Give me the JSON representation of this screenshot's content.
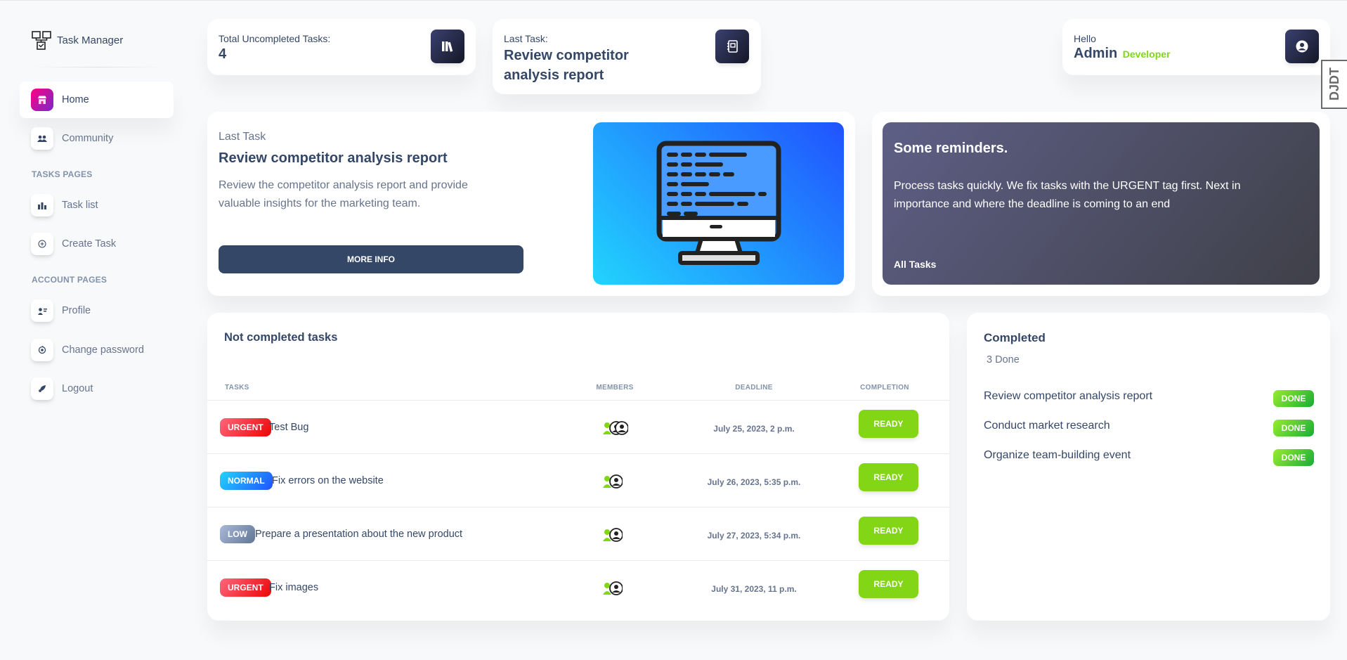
{
  "brand": {
    "name": "Task Manager",
    "icon": "sitemap-icon"
  },
  "sidebar": {
    "items": [
      {
        "label": "Home",
        "icon": "shop-icon"
      },
      {
        "label": "Community",
        "icon": "people-icon"
      },
      {
        "label": "Task list",
        "icon": "chart-bar-icon"
      },
      {
        "label": "Create Task",
        "icon": "plus-circle-icon"
      },
      {
        "label": "Profile",
        "icon": "user-card-icon"
      },
      {
        "label": "Change password",
        "icon": "key-icon"
      },
      {
        "label": "Logout",
        "icon": "rocket-icon"
      }
    ],
    "sections": {
      "tasks": "TASKS PAGES",
      "account": "ACCOUNT PAGES"
    }
  },
  "stats": {
    "uncompleted": {
      "label": "Total Uncompleted Tasks:",
      "value": "4",
      "icon": "books-icon"
    },
    "last_task": {
      "label": "Last Task:",
      "value_line1": "Review competitor",
      "value_line2": "analysis report",
      "icon": "notebook-icon"
    },
    "user": {
      "greeting": "Hello",
      "name": "Admin",
      "role": "Developer",
      "icon": "user-circle-icon"
    }
  },
  "hero": {
    "eyebrow": "Last Task",
    "title": "Review competitor analysis report",
    "description_line1": "Review the competitor analysis report and provide",
    "description_line2": "valuable insights for the marketing team.",
    "button": "MORE INFO",
    "image_icon": "monitor-code-icon"
  },
  "reminders": {
    "title": "Some reminders.",
    "text_line1": "Process tasks quickly. We fix tasks with the URGENT tag first. Next in",
    "text_line2": "importance and where the deadline is coming to an end",
    "link": "All Tasks"
  },
  "tasks_table": {
    "title": "Not completed tasks",
    "headers": [
      "TASKS",
      "MEMBERS",
      "DEADLINE",
      "COMPLETION"
    ],
    "rows": [
      {
        "priority": "URGENT",
        "priority_color": "#ea0606",
        "name": "Test Bug",
        "deadline": "July 25, 2023, 2 p.m.",
        "action": "READY",
        "members": 3
      },
      {
        "priority": "NORMAL",
        "priority_color": "#21d4fd",
        "name": "Fix errors on the website",
        "deadline": "July 26, 2023, 5:35 p.m.",
        "action": "READY",
        "members": 2
      },
      {
        "priority": "LOW",
        "priority_color": "#8392ab",
        "name": "Prepare a presentation about the new product",
        "deadline": "July 27, 2023, 5:34 p.m.",
        "action": "READY",
        "members": 2
      },
      {
        "priority": "URGENT",
        "priority_color": "#ea0606",
        "name": "Fix images",
        "deadline": "July 31, 2023, 11 p.m.",
        "action": "READY",
        "members": 2
      }
    ]
  },
  "completed": {
    "title": "Completed",
    "count": "3 Done",
    "items": [
      {
        "name": "Review competitor analysis report",
        "badge": "DONE"
      },
      {
        "name": "Conduct market research",
        "badge": "DONE"
      },
      {
        "name": "Organize team-building event",
        "badge": "DONE"
      }
    ]
  },
  "debug_toolbar": {
    "label": "DJDT"
  }
}
